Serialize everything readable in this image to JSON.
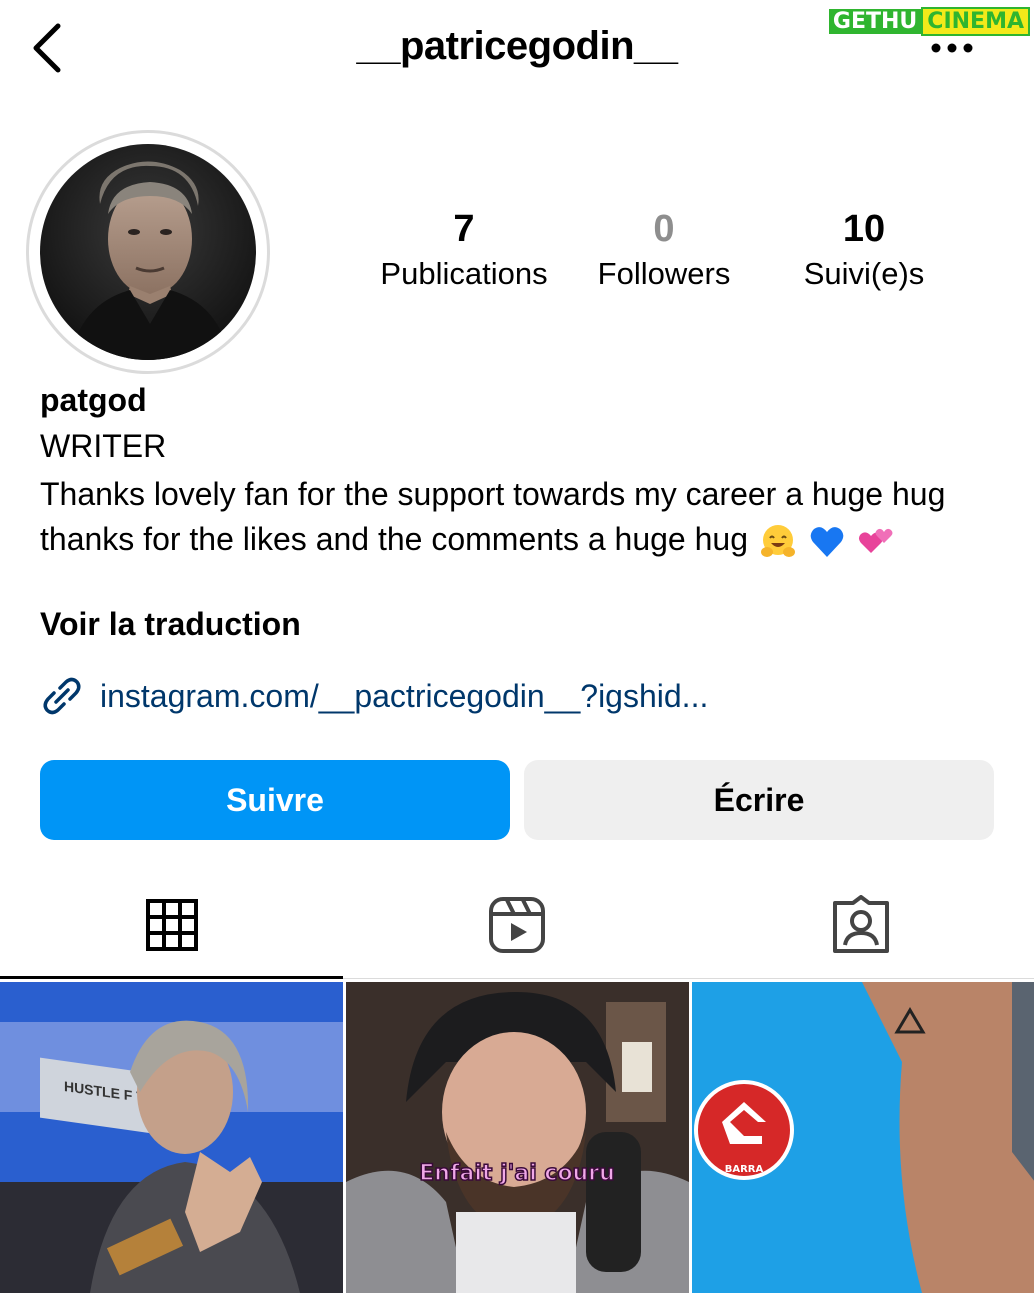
{
  "header": {
    "title": "__patricegodin__",
    "watermark_left": "GETHU",
    "watermark_right": "CINEMA"
  },
  "stats": [
    {
      "value": "7",
      "label": "Publications"
    },
    {
      "value": "0",
      "label": "Followers"
    },
    {
      "value": "10",
      "label": "Suivi(e)s"
    }
  ],
  "profile": {
    "name": "patgod",
    "category": "WRITER",
    "bio_text": "Thanks lovely fan for the support towards my career a huge hug thanks for the likes and the comments a huge hug",
    "bio_emojis": [
      "hugging-face",
      "blue-heart",
      "two-hearts"
    ],
    "translate_label": "Voir la traduction",
    "link": "instagram.com/__pactricegodin__?igshid..."
  },
  "actions": {
    "follow_label": "Suivre",
    "message_label": "Écrire"
  },
  "tabs": [
    {
      "icon": "grid-icon",
      "active": true
    },
    {
      "icon": "reels-icon",
      "active": false
    },
    {
      "icon": "tagged-icon",
      "active": false
    }
  ],
  "posts": [
    {
      "overlay_text": "HUSTLE F THAT MU"
    },
    {
      "overlay_text": "Enfait j'ai couru"
    },
    {
      "overlay_text": "BARRA"
    }
  ],
  "colors": {
    "primary_button": "#0095f6",
    "secondary_button": "#efefef",
    "link": "#00376b",
    "muted": "#8e8e8e"
  }
}
